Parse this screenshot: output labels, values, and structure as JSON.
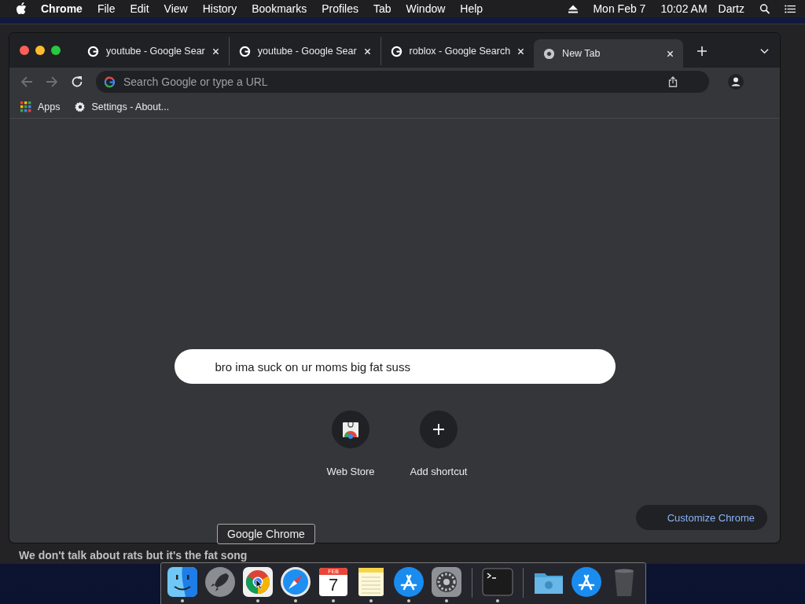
{
  "menu_bar": {
    "app": "Chrome",
    "items": [
      "File",
      "Edit",
      "View",
      "History",
      "Bookmarks",
      "Profiles",
      "Tab",
      "Window",
      "Help"
    ],
    "date": "Mon Feb 7",
    "time": "10:02 AM",
    "user": "Dartz"
  },
  "background_window": {
    "caption": "We don't talk about rats but it's the fat song"
  },
  "tabs": [
    {
      "label": "youtube - Google Sear",
      "kind": "google",
      "selected": false
    },
    {
      "label": "youtube - Google Sear",
      "kind": "google",
      "selected": false
    },
    {
      "label": "roblox - Google Search",
      "kind": "google",
      "selected": false
    },
    {
      "label": "New Tab",
      "kind": "chrome",
      "selected": true
    }
  ],
  "address_bar": {
    "placeholder": "Search Google or type a URL"
  },
  "bookmarks": [
    {
      "label": "Apps",
      "kind": "apps"
    },
    {
      "label": "Settings - About...",
      "kind": "settings"
    }
  ],
  "search_box": {
    "value": "bro ima suck on ur moms big fat suss"
  },
  "shortcuts": [
    {
      "label": "Web Store",
      "kind": "store"
    },
    {
      "label": "Add shortcut",
      "kind": "add"
    }
  ],
  "customize_button": "Customize Chrome",
  "tooltip": "Google Chrome",
  "dock": [
    {
      "kind": "finder",
      "running": true
    },
    {
      "kind": "rocket",
      "running": false
    },
    {
      "kind": "chrome",
      "running": true
    },
    {
      "kind": "safari",
      "running": true
    },
    {
      "kind": "calendar",
      "running": true,
      "day": "7",
      "month": "FEB"
    },
    {
      "kind": "notes",
      "running": true
    },
    {
      "kind": "appstore",
      "running": true
    },
    {
      "kind": "prefs",
      "running": true
    },
    {
      "kind": "divider"
    },
    {
      "kind": "terminal",
      "running": true
    },
    {
      "kind": "divider"
    },
    {
      "kind": "folder",
      "running": false
    },
    {
      "kind": "appstore",
      "running": false
    },
    {
      "kind": "trash",
      "running": false
    }
  ]
}
